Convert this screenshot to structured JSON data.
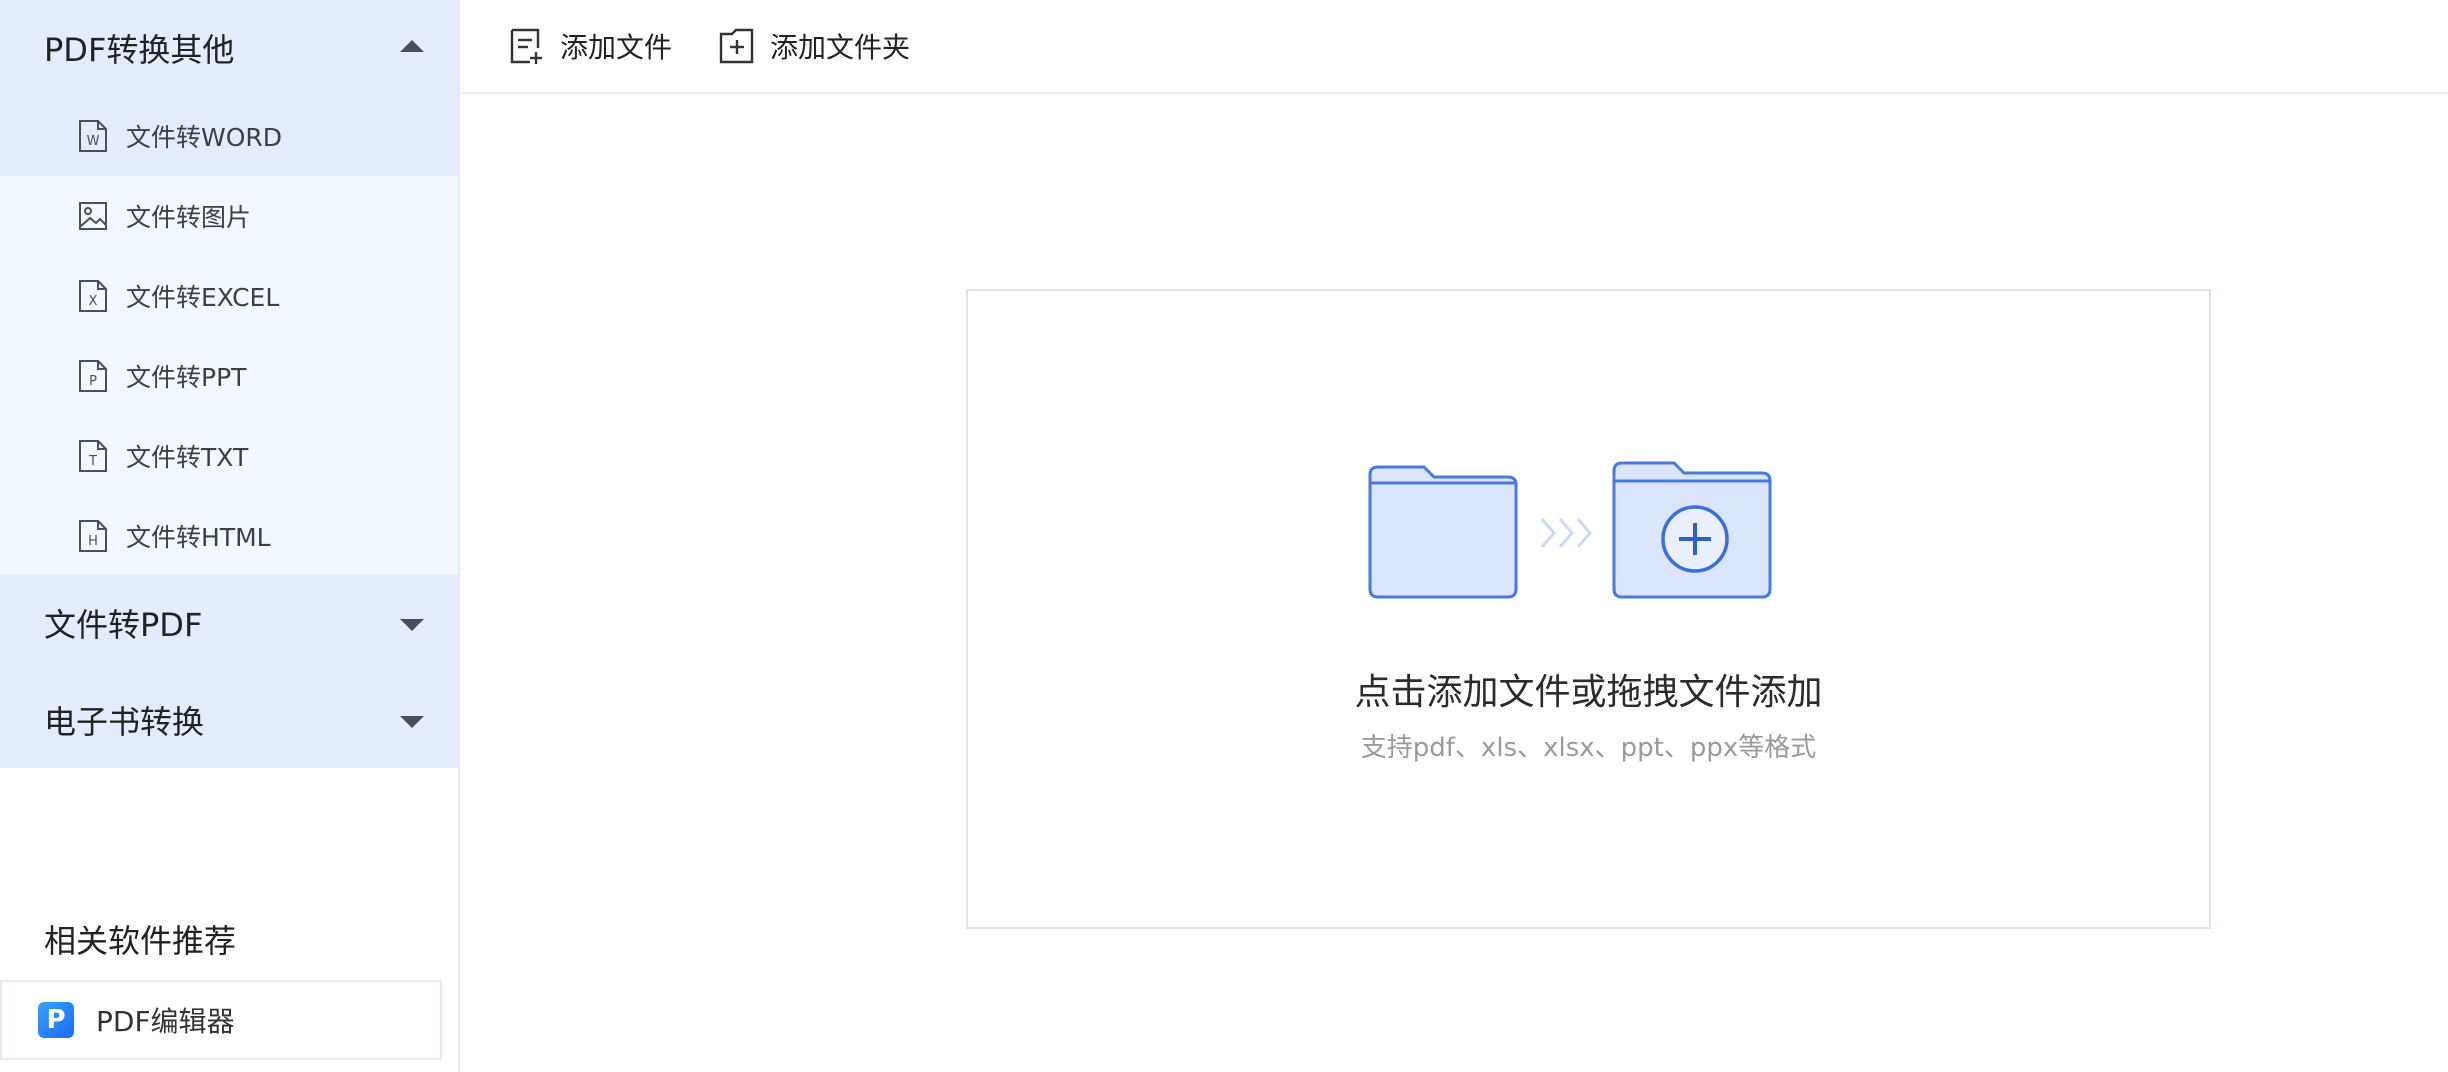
{
  "sidebar": {
    "groups": [
      {
        "label": "PDF转换其他",
        "expanded": true
      },
      {
        "label": "文件转PDF",
        "expanded": false
      },
      {
        "label": "电子书转换",
        "expanded": false
      }
    ],
    "subitems": [
      {
        "label": "文件转WORD",
        "icon": "word-file-icon",
        "letter": "W",
        "active": true
      },
      {
        "label": "文件转图片",
        "icon": "image-file-icon",
        "letter": "",
        "active": false
      },
      {
        "label": "文件转EXCEL",
        "icon": "excel-file-icon",
        "letter": "X",
        "active": false
      },
      {
        "label": "文件转PPT",
        "icon": "ppt-file-icon",
        "letter": "P",
        "active": false
      },
      {
        "label": "文件转TXT",
        "icon": "txt-file-icon",
        "letter": "T",
        "active": false
      },
      {
        "label": "文件转HTML",
        "icon": "html-file-icon",
        "letter": "H",
        "active": false
      }
    ],
    "recommend": {
      "title": "相关软件推荐",
      "items": [
        {
          "label": "PDF编辑器",
          "icon": "pdf-editor-logo-icon",
          "logo_letter": "P"
        }
      ]
    }
  },
  "toolbar": {
    "add_file": "添加文件",
    "add_folder": "添加文件夹"
  },
  "dropzone": {
    "title": "点击添加文件或拖拽文件添加",
    "subtitle": "支持pdf、xls、xlsx、ppt、ppx等格式"
  },
  "colors": {
    "accent": "#3b6fe0",
    "folder_fill": "#dbe6fd",
    "group_bg": "#e4ecfd",
    "submenu_bg": "#f3f7fe"
  }
}
